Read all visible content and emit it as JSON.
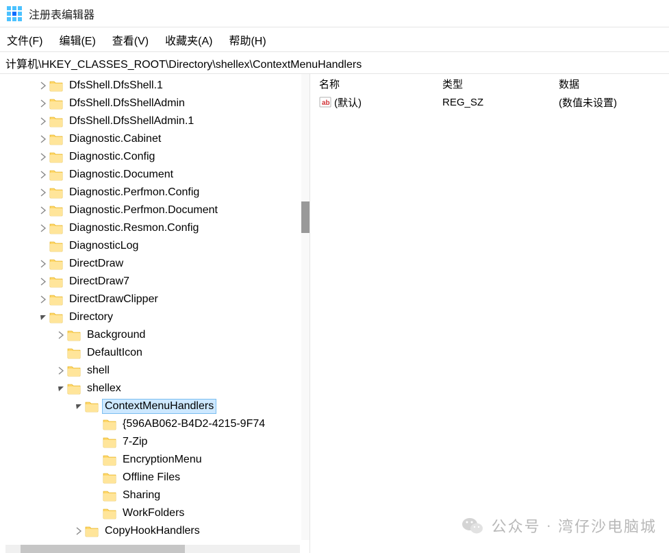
{
  "window": {
    "title": "注册表编辑器"
  },
  "menu": {
    "file": "文件(F)",
    "edit": "编辑(E)",
    "view": "查看(V)",
    "favorites": "收藏夹(A)",
    "help": "帮助(H)"
  },
  "address": "计算机\\HKEY_CLASSES_ROOT\\Directory\\shellex\\ContextMenuHandlers",
  "tree": [
    {
      "level": 0,
      "chev": "closed",
      "label": "DfsShell.DfsShell.1"
    },
    {
      "level": 0,
      "chev": "closed",
      "label": "DfsShell.DfsShellAdmin"
    },
    {
      "level": 0,
      "chev": "closed",
      "label": "DfsShell.DfsShellAdmin.1"
    },
    {
      "level": 0,
      "chev": "closed",
      "label": "Diagnostic.Cabinet"
    },
    {
      "level": 0,
      "chev": "closed",
      "label": "Diagnostic.Config"
    },
    {
      "level": 0,
      "chev": "closed",
      "label": "Diagnostic.Document"
    },
    {
      "level": 0,
      "chev": "closed",
      "label": "Diagnostic.Perfmon.Config"
    },
    {
      "level": 0,
      "chev": "closed",
      "label": "Diagnostic.Perfmon.Document"
    },
    {
      "level": 0,
      "chev": "closed",
      "label": "Diagnostic.Resmon.Config"
    },
    {
      "level": 0,
      "chev": "none",
      "label": "DiagnosticLog"
    },
    {
      "level": 0,
      "chev": "closed",
      "label": "DirectDraw"
    },
    {
      "level": 0,
      "chev": "closed",
      "label": "DirectDraw7"
    },
    {
      "level": 0,
      "chev": "closed",
      "label": "DirectDrawClipper"
    },
    {
      "level": 0,
      "chev": "open",
      "label": "Directory"
    },
    {
      "level": 1,
      "chev": "closed",
      "label": "Background"
    },
    {
      "level": 1,
      "chev": "none",
      "label": "DefaultIcon"
    },
    {
      "level": 1,
      "chev": "closed",
      "label": "shell"
    },
    {
      "level": 1,
      "chev": "open",
      "label": "shellex"
    },
    {
      "level": 2,
      "chev": "open",
      "label": "ContextMenuHandlers",
      "selected": true
    },
    {
      "level": 3,
      "chev": "none",
      "label": "{596AB062-B4D2-4215-9F74"
    },
    {
      "level": 3,
      "chev": "none",
      "label": "7-Zip"
    },
    {
      "level": 3,
      "chev": "none",
      "label": "EncryptionMenu"
    },
    {
      "level": 3,
      "chev": "none",
      "label": "Offline Files"
    },
    {
      "level": 3,
      "chev": "none",
      "label": "Sharing"
    },
    {
      "level": 3,
      "chev": "none",
      "label": "WorkFolders"
    },
    {
      "level": 2,
      "chev": "closed",
      "label": "CopyHookHandlers"
    }
  ],
  "list": {
    "headers": {
      "name": "名称",
      "type": "类型",
      "data": "数据"
    },
    "rows": [
      {
        "name": "(默认)",
        "type": "REG_SZ",
        "data": "(数值未设置)"
      }
    ]
  },
  "watermark": {
    "prefix": "公众号",
    "name": "湾仔沙电脑城"
  }
}
